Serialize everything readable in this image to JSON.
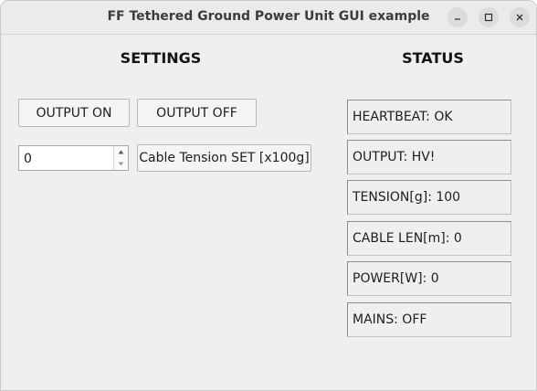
{
  "window": {
    "title": "FF Tethered Ground Power Unit GUI example",
    "controls": [
      "minimize-icon",
      "maximize-icon",
      "close-icon"
    ]
  },
  "settings": {
    "heading": "SETTINGS",
    "output_on_label": "OUTPUT ON",
    "output_off_label": "OUTPUT OFF",
    "tension_value": "0",
    "tension_set_label": "Cable Tension SET [x100g]"
  },
  "status": {
    "heading": "STATUS",
    "items": [
      "HEARTBEAT: OK",
      "OUTPUT: HV!",
      "TENSION[g]: 100",
      "CABLE LEN[m]: 0",
      "POWER[W]: 0",
      "MAINS: OFF"
    ]
  },
  "colors": {
    "window_bg": "#efefef",
    "titlebar_bg": "#ebebeb",
    "button_bg": "#f4f4f4"
  }
}
